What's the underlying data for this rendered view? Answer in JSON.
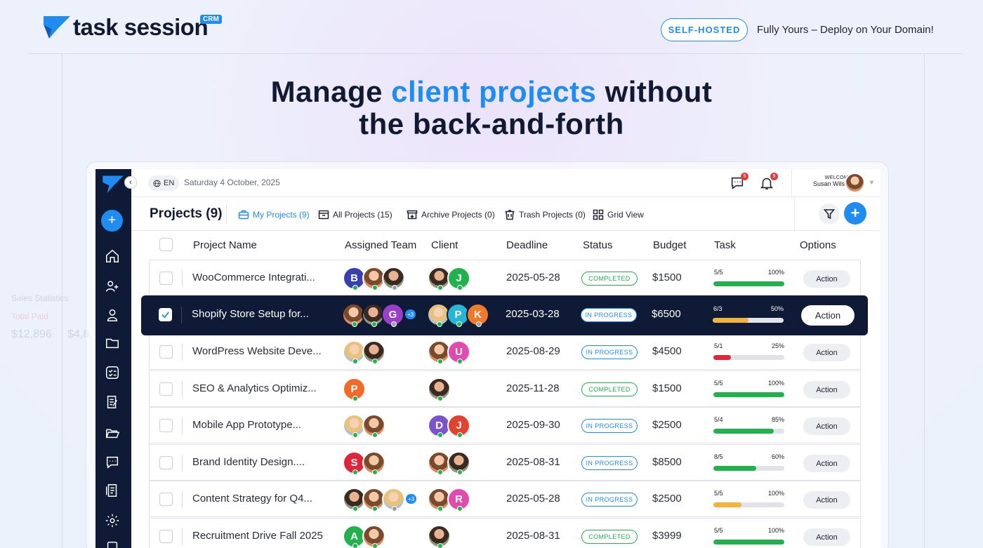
{
  "brand": {
    "name": "task session",
    "badge": "CRM"
  },
  "promo": {
    "pill": "SELF-HOSTED",
    "tagline": "Fully Yours – Deploy on Your Domain!"
  },
  "headline": {
    "part1": "Manage ",
    "highlight": "client projects",
    "part2": " without",
    "line2": "the back-and-forth"
  },
  "colors": {
    "accent": "#1e8cf0",
    "navy": "#0e1a36",
    "green": "#22b14c",
    "orange": "#f5b335",
    "red": "#e0243c"
  },
  "ghost": {
    "title": "Sales Statistics",
    "label1": "Total Paid",
    "value1": "$12,896",
    "value2": "$4,8"
  },
  "app": {
    "lang": "EN",
    "date": "Saturday 4 October, 2025",
    "messages_count": "5",
    "notifications_count": "9",
    "welcome": "WELCOME",
    "user": "Susan Wilson",
    "page_title": "Projects (9)",
    "tabs": [
      {
        "label": "My Projects (9)",
        "icon": "briefcase-icon"
      },
      {
        "label": "All Projects (15)",
        "icon": "inbox-icon"
      },
      {
        "label": "Archive Projects (0)",
        "icon": "archive-icon"
      },
      {
        "label": "Trash Projects (0)",
        "icon": "trash-icon"
      },
      {
        "label": "Grid View",
        "icon": "grid-icon"
      }
    ],
    "sidebar_icons": [
      "home-icon",
      "users-icon",
      "user-icon",
      "folder-icon",
      "tasks-icon",
      "notes-icon",
      "folder-open-icon",
      "chat-icon",
      "invoice-icon",
      "settings-icon"
    ],
    "columns": [
      "Project Name",
      "Assigned Team",
      "Client",
      "Deadline",
      "Status",
      "Budget",
      "Task",
      "Options"
    ],
    "rows": [
      {
        "name": "WooCommerce Integrati...",
        "deadline": "2025-05-28",
        "status": "COMPLETED",
        "budget": "$1500",
        "task": "5/5",
        "pct": "100%",
        "progress": 1.0,
        "bar": "green",
        "action": "Action",
        "team": [
          {
            "l": "B",
            "c": "#3a3fb0"
          },
          {
            "p": "f1"
          },
          {
            "p": "f3"
          }
        ],
        "team_more": "",
        "client": [
          {
            "p": "f3"
          },
          {
            "l": "J",
            "c": "#22b14c"
          }
        ]
      },
      {
        "name": "Shopify Store Setup for...",
        "deadline": "2025-03-28",
        "status": "IN PROGRESS",
        "budget": "$6500",
        "task": "6/3",
        "pct": "50%",
        "progress": 0.5,
        "bar": "orange",
        "action": "Action",
        "selected": true,
        "team": [
          {
            "p": "f1"
          },
          {
            "p": "f3"
          },
          {
            "l": "G",
            "c": "#9b3fc9"
          }
        ],
        "team_more": "+3",
        "client": [
          {
            "p": "f2"
          },
          {
            "l": "P",
            "c": "#29b6d6"
          },
          {
            "l": "K",
            "c": "#f07a2a"
          }
        ]
      },
      {
        "name": "WordPress Website Deve...",
        "deadline": "2025-08-29",
        "status": "IN PROGRESS",
        "budget": "$4500",
        "task": "5/1",
        "pct": "25%",
        "progress": 0.25,
        "bar": "red",
        "action": "Action",
        "team": [
          {
            "p": "f2"
          },
          {
            "p": "f3"
          }
        ],
        "team_more": "",
        "client": [
          {
            "p": "f1"
          },
          {
            "l": "U",
            "c": "#e04bb0"
          }
        ]
      },
      {
        "name": "SEO & Analytics Optimiz...",
        "deadline": "2025-11-28",
        "status": "COMPLETED",
        "budget": "$1500",
        "task": "5/5",
        "pct": "100%",
        "progress": 1.0,
        "bar": "green",
        "action": "Action",
        "team": [
          {
            "l": "P",
            "c": "#f06a2a"
          }
        ],
        "team_more": "",
        "client": [
          {
            "p": "f3"
          }
        ]
      },
      {
        "name": "Mobile App Prototype...",
        "deadline": "2025-09-30",
        "status": "IN PROGRESS",
        "budget": "$2500",
        "task": "5/4",
        "pct": "85%",
        "progress": 0.85,
        "bar": "green",
        "action": "Action",
        "team": [
          {
            "p": "f2"
          },
          {
            "p": "f1"
          }
        ],
        "team_more": "",
        "client": [
          {
            "l": "D",
            "c": "#7a55c9"
          },
          {
            "l": "J",
            "c": "#e2432f"
          }
        ]
      },
      {
        "name": "Brand Identity Design....",
        "deadline": "2025-08-31",
        "status": "IN PROGRESS",
        "budget": "$8500",
        "task": "8/5",
        "pct": "60%",
        "progress": 0.6,
        "bar": "green",
        "action": "Action",
        "team": [
          {
            "l": "S",
            "c": "#e0243c"
          },
          {
            "p": "f1"
          }
        ],
        "team_more": "",
        "client": [
          {
            "p": "f1"
          },
          {
            "p": "f3"
          }
        ]
      },
      {
        "name": "Content Strategy for Q4...",
        "deadline": "2025-05-28",
        "status": "IN PROGRESS",
        "budget": "$2500",
        "task": "5/5",
        "pct": "100%",
        "progress": 0.4,
        "bar": "orange",
        "action": "Action",
        "team": [
          {
            "p": "f3"
          },
          {
            "p": "f1"
          },
          {
            "p": "f2"
          }
        ],
        "team_more": "+3",
        "client": [
          {
            "p": "f1"
          },
          {
            "l": "R",
            "c": "#e04bb0"
          }
        ]
      },
      {
        "name": "Recruitment Drive Fall 2025",
        "deadline": "2025-08-31",
        "status": "COMPLETED",
        "budget": "$3999",
        "task": "5/5",
        "pct": "100%",
        "progress": 1.0,
        "bar": "green",
        "action": "Action",
        "team": [
          {
            "l": "A",
            "c": "#22b14c"
          },
          {
            "p": "f1"
          }
        ],
        "team_more": "",
        "client": [
          {
            "p": "f3"
          }
        ]
      }
    ]
  }
}
